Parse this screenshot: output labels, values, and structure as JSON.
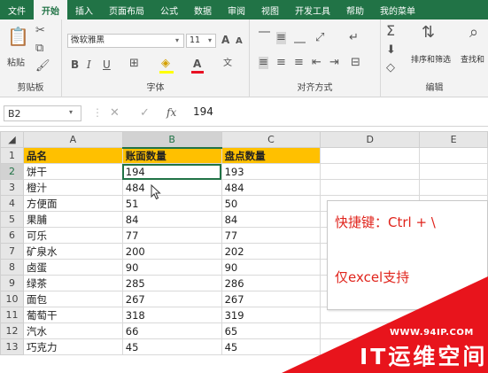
{
  "ribbon_tabs": [
    "文件",
    "开始",
    "插入",
    "页面布局",
    "公式",
    "数据",
    "审阅",
    "视图",
    "开发工具",
    "帮助",
    "我的菜单"
  ],
  "active_tab": "开始",
  "ribbon": {
    "clipboard": {
      "label": "剪贴板",
      "paste": "粘贴"
    },
    "font": {
      "label": "字体",
      "name": "微软雅黑",
      "size": "11",
      "bold": "B",
      "italic": "I",
      "underline": "U",
      "grow": "A",
      "shrink": "A",
      "color_letter": "A",
      "phonetic": "文"
    },
    "alignment": {
      "label": "对齐方式"
    },
    "editing": {
      "label": "编辑",
      "sort_filter": "排序和筛选",
      "find_select": "查找和"
    }
  },
  "formula_bar": {
    "name_box": "B2",
    "fx": "fx",
    "formula": "194"
  },
  "columns": [
    "A",
    "B",
    "C",
    "D",
    "E"
  ],
  "rows": [
    {
      "n": "1",
      "a": "品名",
      "b": "账面数量",
      "c": "盘点数量"
    },
    {
      "n": "2",
      "a": "饼干",
      "b": "194",
      "c": "193"
    },
    {
      "n": "3",
      "a": "橙汁",
      "b": "484",
      "c": "484"
    },
    {
      "n": "4",
      "a": "方便面",
      "b": "51",
      "c": "50"
    },
    {
      "n": "5",
      "a": "果脯",
      "b": "84",
      "c": "84"
    },
    {
      "n": "6",
      "a": "可乐",
      "b": "77",
      "c": "77"
    },
    {
      "n": "7",
      "a": "矿泉水",
      "b": "200",
      "c": "202"
    },
    {
      "n": "8",
      "a": "卤蛋",
      "b": "90",
      "c": "90"
    },
    {
      "n": "9",
      "a": "绿茶",
      "b": "285",
      "c": "286"
    },
    {
      "n": "10",
      "a": "面包",
      "b": "267",
      "c": "267"
    },
    {
      "n": "11",
      "a": "葡萄干",
      "b": "318",
      "c": "319"
    },
    {
      "n": "12",
      "a": "汽水",
      "b": "66",
      "c": "65"
    },
    {
      "n": "13",
      "a": "巧克力",
      "b": "45",
      "c": "45"
    }
  ],
  "note": {
    "line1": "快捷键：Ctrl + \\",
    "line2": "仅excel支持"
  },
  "watermark": {
    "url": "WWW.94IP.COM",
    "name": "IT运维空间"
  },
  "colors": {
    "excel_green": "#217346",
    "header_fill": "#ffc000",
    "note_text": "#e0241c",
    "watermark_red": "#e8141c"
  }
}
